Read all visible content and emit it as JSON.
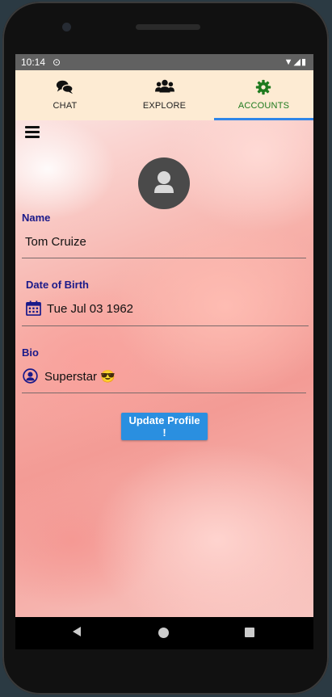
{
  "status_bar": {
    "time": "10:14",
    "sync_glyph": "⊙",
    "right_glyphs": "▼◢▮"
  },
  "tabs": [
    {
      "label": "CHAT",
      "icon": "chat-bubbles-icon",
      "active": false
    },
    {
      "label": "EXPLORE",
      "icon": "users-group-icon",
      "active": false
    },
    {
      "label": "ACCOUNTS",
      "icon": "gear-icon",
      "active": true
    }
  ],
  "colors": {
    "tab_bar_bg": "#fdebd3",
    "active_tab": "#1e7a1e",
    "indicator": "#2f86e8",
    "label_color": "#1a1a8a",
    "button_bg": "#2a8fe0"
  },
  "profile": {
    "name_label": "Name",
    "name_value": "Tom Cruize",
    "dob_label": "Date of Birth",
    "dob_value": "Tue Jul 03 1962",
    "bio_label": "Bio",
    "bio_value": "Superstar 😎",
    "update_button": "Update Profile !"
  }
}
